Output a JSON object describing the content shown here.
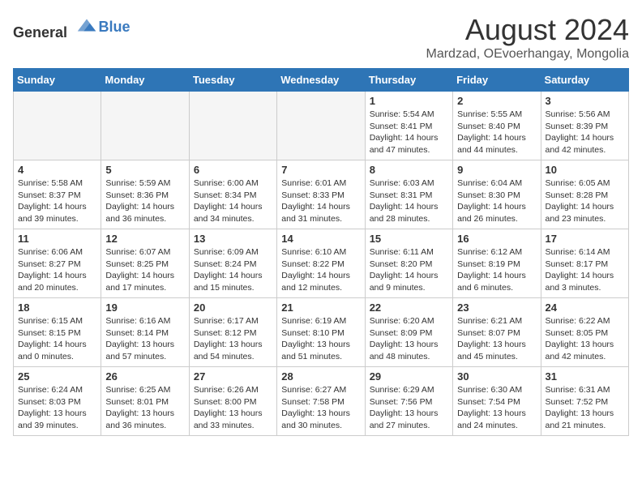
{
  "logo": {
    "general": "General",
    "blue": "Blue"
  },
  "header": {
    "title": "August 2024",
    "subtitle": "Mardzad, OEvoerhangay, Mongolia"
  },
  "weekdays": [
    "Sunday",
    "Monday",
    "Tuesday",
    "Wednesday",
    "Thursday",
    "Friday",
    "Saturday"
  ],
  "weeks": [
    [
      {
        "day": "",
        "info": ""
      },
      {
        "day": "",
        "info": ""
      },
      {
        "day": "",
        "info": ""
      },
      {
        "day": "",
        "info": ""
      },
      {
        "day": "1",
        "info": "Sunrise: 5:54 AM\nSunset: 8:41 PM\nDaylight: 14 hours and 47 minutes."
      },
      {
        "day": "2",
        "info": "Sunrise: 5:55 AM\nSunset: 8:40 PM\nDaylight: 14 hours and 44 minutes."
      },
      {
        "day": "3",
        "info": "Sunrise: 5:56 AM\nSunset: 8:39 PM\nDaylight: 14 hours and 42 minutes."
      }
    ],
    [
      {
        "day": "4",
        "info": "Sunrise: 5:58 AM\nSunset: 8:37 PM\nDaylight: 14 hours and 39 minutes."
      },
      {
        "day": "5",
        "info": "Sunrise: 5:59 AM\nSunset: 8:36 PM\nDaylight: 14 hours and 36 minutes."
      },
      {
        "day": "6",
        "info": "Sunrise: 6:00 AM\nSunset: 8:34 PM\nDaylight: 14 hours and 34 minutes."
      },
      {
        "day": "7",
        "info": "Sunrise: 6:01 AM\nSunset: 8:33 PM\nDaylight: 14 hours and 31 minutes."
      },
      {
        "day": "8",
        "info": "Sunrise: 6:03 AM\nSunset: 8:31 PM\nDaylight: 14 hours and 28 minutes."
      },
      {
        "day": "9",
        "info": "Sunrise: 6:04 AM\nSunset: 8:30 PM\nDaylight: 14 hours and 26 minutes."
      },
      {
        "day": "10",
        "info": "Sunrise: 6:05 AM\nSunset: 8:28 PM\nDaylight: 14 hours and 23 minutes."
      }
    ],
    [
      {
        "day": "11",
        "info": "Sunrise: 6:06 AM\nSunset: 8:27 PM\nDaylight: 14 hours and 20 minutes."
      },
      {
        "day": "12",
        "info": "Sunrise: 6:07 AM\nSunset: 8:25 PM\nDaylight: 14 hours and 17 minutes."
      },
      {
        "day": "13",
        "info": "Sunrise: 6:09 AM\nSunset: 8:24 PM\nDaylight: 14 hours and 15 minutes."
      },
      {
        "day": "14",
        "info": "Sunrise: 6:10 AM\nSunset: 8:22 PM\nDaylight: 14 hours and 12 minutes."
      },
      {
        "day": "15",
        "info": "Sunrise: 6:11 AM\nSunset: 8:20 PM\nDaylight: 14 hours and 9 minutes."
      },
      {
        "day": "16",
        "info": "Sunrise: 6:12 AM\nSunset: 8:19 PM\nDaylight: 14 hours and 6 minutes."
      },
      {
        "day": "17",
        "info": "Sunrise: 6:14 AM\nSunset: 8:17 PM\nDaylight: 14 hours and 3 minutes."
      }
    ],
    [
      {
        "day": "18",
        "info": "Sunrise: 6:15 AM\nSunset: 8:15 PM\nDaylight: 14 hours and 0 minutes."
      },
      {
        "day": "19",
        "info": "Sunrise: 6:16 AM\nSunset: 8:14 PM\nDaylight: 13 hours and 57 minutes."
      },
      {
        "day": "20",
        "info": "Sunrise: 6:17 AM\nSunset: 8:12 PM\nDaylight: 13 hours and 54 minutes."
      },
      {
        "day": "21",
        "info": "Sunrise: 6:19 AM\nSunset: 8:10 PM\nDaylight: 13 hours and 51 minutes."
      },
      {
        "day": "22",
        "info": "Sunrise: 6:20 AM\nSunset: 8:09 PM\nDaylight: 13 hours and 48 minutes."
      },
      {
        "day": "23",
        "info": "Sunrise: 6:21 AM\nSunset: 8:07 PM\nDaylight: 13 hours and 45 minutes."
      },
      {
        "day": "24",
        "info": "Sunrise: 6:22 AM\nSunset: 8:05 PM\nDaylight: 13 hours and 42 minutes."
      }
    ],
    [
      {
        "day": "25",
        "info": "Sunrise: 6:24 AM\nSunset: 8:03 PM\nDaylight: 13 hours and 39 minutes."
      },
      {
        "day": "26",
        "info": "Sunrise: 6:25 AM\nSunset: 8:01 PM\nDaylight: 13 hours and 36 minutes."
      },
      {
        "day": "27",
        "info": "Sunrise: 6:26 AM\nSunset: 8:00 PM\nDaylight: 13 hours and 33 minutes."
      },
      {
        "day": "28",
        "info": "Sunrise: 6:27 AM\nSunset: 7:58 PM\nDaylight: 13 hours and 30 minutes."
      },
      {
        "day": "29",
        "info": "Sunrise: 6:29 AM\nSunset: 7:56 PM\nDaylight: 13 hours and 27 minutes."
      },
      {
        "day": "30",
        "info": "Sunrise: 6:30 AM\nSunset: 7:54 PM\nDaylight: 13 hours and 24 minutes."
      },
      {
        "day": "31",
        "info": "Sunrise: 6:31 AM\nSunset: 7:52 PM\nDaylight: 13 hours and 21 minutes."
      }
    ]
  ]
}
